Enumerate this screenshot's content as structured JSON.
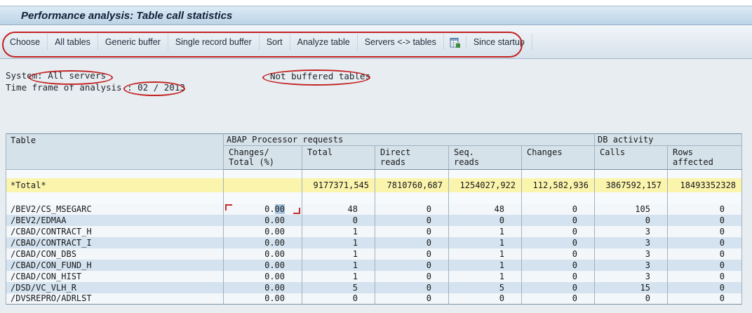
{
  "window": {
    "title": "Performance analysis: Table call statistics"
  },
  "toolbar": {
    "items": [
      "Choose",
      "All tables",
      "Generic buffer",
      "Single record buffer",
      "Sort",
      "Analyze table",
      "Servers <-> tables",
      "Since startup"
    ],
    "icons": {
      "spreadsheet": "spreadsheet-icon"
    }
  },
  "filters": {
    "system_label": "System:",
    "system_value": "All servers",
    "buffer_status": "Not buffered tables",
    "timeframe_label": "Time frame of analysis :",
    "timeframe_value": "02 / 2013"
  },
  "table": {
    "first_col_header": "Table",
    "group_headers": {
      "abap": "ABAP Processor requests",
      "db": "DB activity"
    },
    "subheaders": [
      "Changes/\nTotal (%)",
      "Total",
      "Direct\nreads",
      "Seq.\nreads",
      "Changes",
      "Calls",
      "Rows\naffected"
    ],
    "total_row": [
      "*Total*",
      "",
      "9177371,545",
      "7810760,687",
      "1254027,922",
      "112,582,936",
      "3867592,157",
      "18493352328"
    ],
    "rows": [
      [
        "/BEV2/CS_MSEGARC",
        "0.00",
        "48",
        "0",
        "48",
        "0",
        "105",
        "0"
      ],
      [
        "/BEV2/EDMAA",
        "0.00",
        "0",
        "0",
        "0",
        "0",
        "0",
        "0"
      ],
      [
        "/CBAD/CONTRACT_H",
        "0.00",
        "1",
        "0",
        "1",
        "0",
        "3",
        "0"
      ],
      [
        "/CBAD/CONTRACT_I",
        "0.00",
        "1",
        "0",
        "1",
        "0",
        "3",
        "0"
      ],
      [
        "/CBAD/CON_DBS",
        "0.00",
        "1",
        "0",
        "1",
        "0",
        "3",
        "0"
      ],
      [
        "/CBAD/CON_FUND_H",
        "0.00",
        "1",
        "0",
        "1",
        "0",
        "3",
        "0"
      ],
      [
        "/CBAD/CON_HIST",
        "0.00",
        "1",
        "0",
        "1",
        "0",
        "3",
        "0"
      ],
      [
        "/DSD/VC_VLH_R",
        "0.00",
        "5",
        "0",
        "5",
        "0",
        "15",
        "0"
      ],
      [
        "/DVSREPRO/ADRLST",
        "0.00",
        "0",
        "0",
        "0",
        "0",
        "0",
        "0"
      ]
    ],
    "selected_cell": {
      "row": 0,
      "col": 1
    }
  },
  "colors": {
    "annotation": "#c32222",
    "total_row_bg": "#fbf4ad",
    "alt_row_bg": "#d4e3ef",
    "titlebar_bg": "#c7d9ea"
  }
}
